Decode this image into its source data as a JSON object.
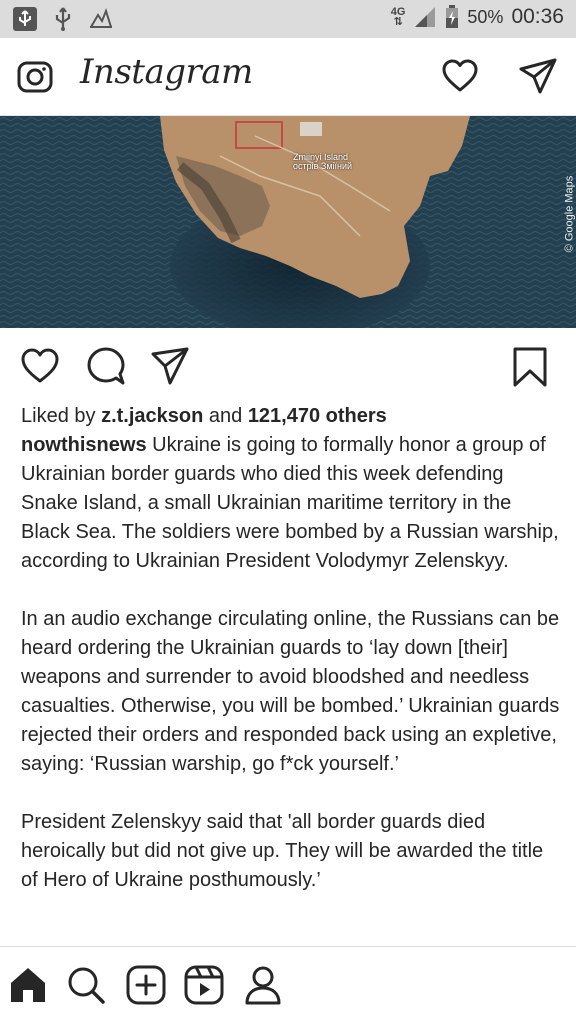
{
  "status_bar": {
    "network": "4G",
    "battery": "50%",
    "time": "00:36"
  },
  "header": {
    "logo": "Instagram"
  },
  "post": {
    "image": {
      "map_label_line1": "Zmiinyi Island",
      "map_label_line2": "острів Зміїний",
      "attribution": "© Google Maps"
    },
    "liked_by_prefix": "Liked by ",
    "liked_by_user": "z.t.jackson",
    "liked_by_and": " and ",
    "liked_by_others": "121,470 others",
    "author": "nowthisnews",
    "caption_p1": "Ukraine is going to formally honor a group of Ukrainian border guards who died this week defending Snake Island, a small Ukrainian maritime territory in the Black Sea. The soldiers were bombed by a Russian warship, according to Ukrainian President Volodymyr Zelenskyy.",
    "caption_p2": "In an audio exchange circulating online, the Russians can be heard ordering the Ukrainian guards to ‘lay down [their] weapons and surrender to avoid bloodshed and needless casualties. Otherwise, you will be bombed.’ Ukrainian guards rejected their orders and responded back using an expletive, saying: ‘Russian warship, go f*ck yourself.’",
    "caption_p3": "President Zelenskyy said that 'all border guards died heroically but did not give up. They will be awarded the title of Hero of Ukraine posthumously.’"
  },
  "icons": {
    "camera": "camera-icon",
    "activity": "heart-icon",
    "direct": "paper-plane-icon",
    "like": "heart-icon",
    "comment": "comment-icon",
    "share": "paper-plane-icon",
    "save": "bookmark-icon",
    "home": "home-icon",
    "search": "search-icon",
    "create": "plus-square-icon",
    "reels": "reels-icon",
    "profile": "profile-icon"
  }
}
